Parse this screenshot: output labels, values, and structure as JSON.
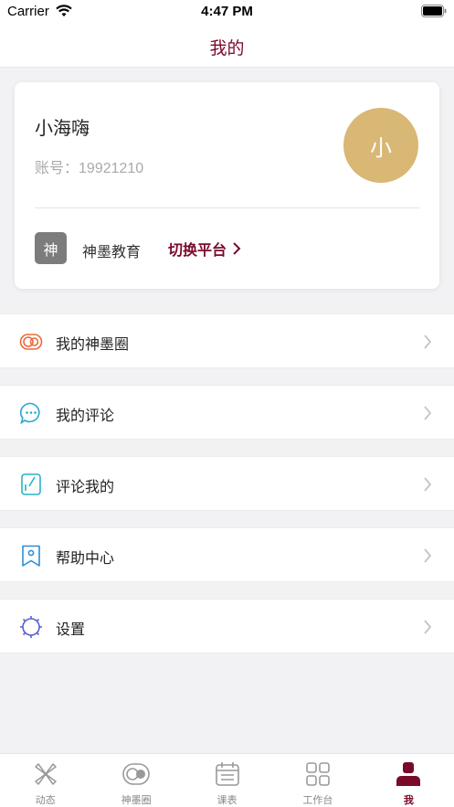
{
  "status_bar": {
    "carrier": "Carrier",
    "time": "4:47 PM"
  },
  "nav": {
    "title": "我的"
  },
  "profile": {
    "name": "小海嗨",
    "account_label": "账号：",
    "account_number": "19921210",
    "avatar_text": "小",
    "org_badge": "神",
    "org_name": "神墨教育",
    "switch_label": "切换平台"
  },
  "menu": [
    {
      "label": "我的神墨圈",
      "icon": "circle-community-icon"
    },
    {
      "label": "我的评论",
      "icon": "chat-bubble-icon"
    },
    {
      "label": "评论我的",
      "icon": "note-edit-icon"
    },
    {
      "label": "帮助中心",
      "icon": "help-bookmark-icon"
    },
    {
      "label": "设置",
      "icon": "gear-icon"
    }
  ],
  "tabs": [
    {
      "label": "动态",
      "icon": "pinwheel-icon"
    },
    {
      "label": "神墨圈",
      "icon": "toggle-circle-icon"
    },
    {
      "label": "课表",
      "icon": "calendar-icon"
    },
    {
      "label": "工作台",
      "icon": "grid-icon"
    },
    {
      "label": "我",
      "icon": "person-icon",
      "active": true
    }
  ],
  "colors": {
    "accent": "#7a0a2a",
    "avatar": "#d9b774",
    "badge": "#7c7c7c"
  }
}
